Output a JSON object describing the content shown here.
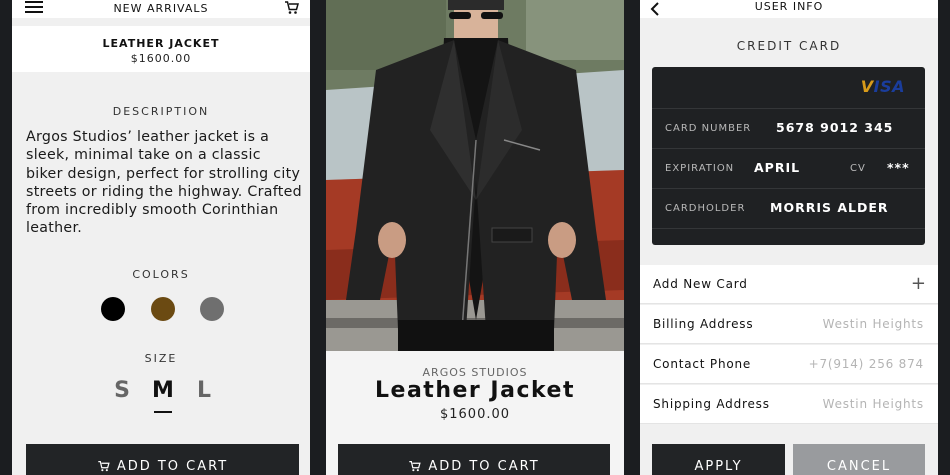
{
  "product_screen": {
    "header_title": "NEW ARRIVALS",
    "product_name": "LEATHER JACKET",
    "product_price": "$1600.00",
    "description_label": "DESCRIPTION",
    "description": "Argos Studios’ leather jacket is a sleek, minimal take on a classic biker design, perfect for strolling city streets or riding the highway. Crafted from incredibly smooth Corinthian leather.",
    "colors_label": "COLORS",
    "colors": [
      "#000000",
      "#6b4a12",
      "#6f6f6f"
    ],
    "size_label": "SIZE",
    "sizes": [
      "S",
      "M",
      "L"
    ],
    "selected_size": "M",
    "add_to_cart": "ADD TO CART"
  },
  "photo_screen": {
    "brand": "ARGOS STUDIOS",
    "title": "Leather Jacket",
    "price": "$1600.00",
    "add_to_cart": "ADD TO CART"
  },
  "user_info_screen": {
    "header_title": "USER INFO",
    "section_title": "CREDIT CARD",
    "card": {
      "brand": "VISA",
      "number_label": "CARD NUMBER",
      "number": "5678 9012 345",
      "expiration_label": "EXPIRATION",
      "expiration": "APRIL",
      "cv_label": "CV",
      "cv": "***",
      "holder_label": "CARDHOLDER",
      "holder": "MORRIS ALDER"
    },
    "rows": [
      {
        "label": "Add New Card",
        "value": "",
        "icon": "plus-icon"
      },
      {
        "label": "Billing Address",
        "value": "Westin Heights"
      },
      {
        "label": "Contact Phone",
        "value": "+7(914) 256 874"
      },
      {
        "label": "Shipping Address",
        "value": "Westin Heights"
      }
    ],
    "apply": "APPLY",
    "cancel": "CANCEL"
  }
}
